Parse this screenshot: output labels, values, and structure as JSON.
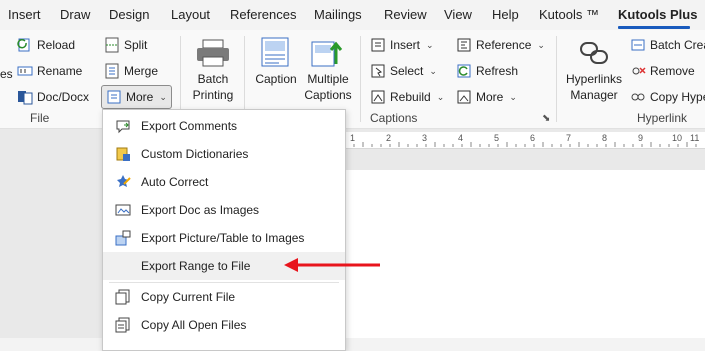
{
  "tabs": [
    "Insert",
    "Draw",
    "Design",
    "Layout",
    "References",
    "Mailings",
    "Review",
    "View",
    "Help",
    "Kutools ™",
    "Kutools Plus"
  ],
  "active_tab": "Kutools Plus",
  "ribbon": {
    "file_group": {
      "col1": [
        "es",
        "",
        ""
      ],
      "col2": [
        "Reload",
        "Rename",
        "Doc/Docx"
      ],
      "col3": [
        "Split",
        "Merge",
        "More"
      ],
      "label": "File"
    },
    "batch_printing": [
      "Batch",
      "Printing"
    ],
    "caption": "Caption",
    "multiple_captions": [
      "Multiple",
      "Captions"
    ],
    "captions_group": {
      "col1": [
        "Insert",
        "Select",
        "Rebuild"
      ],
      "col2": [
        "Reference",
        "Refresh",
        "More"
      ],
      "label": "Captions"
    },
    "hyperlinks_manager": [
      "Hyperlinks",
      "Manager"
    ],
    "hyperlink_group": {
      "items": [
        "Batch Crea",
        "Remove",
        "Copy Hype"
      ],
      "label": "Hyperlink"
    }
  },
  "menu": {
    "items": [
      "Export Comments",
      "Custom Dictionaries",
      "Auto Correct",
      "Export Doc as Images",
      "Export Picture/Table to Images",
      "Export Range to File",
      "Copy Current File",
      "Copy All Open Files"
    ],
    "highlighted": "Export Range to File"
  },
  "ruler_marks": [
    "1",
    "2",
    "3",
    "4",
    "5",
    "6",
    "7",
    "8",
    "9",
    "10",
    "11"
  ],
  "colors": {
    "accent": "#185abd",
    "arrow": "#e8141c"
  }
}
